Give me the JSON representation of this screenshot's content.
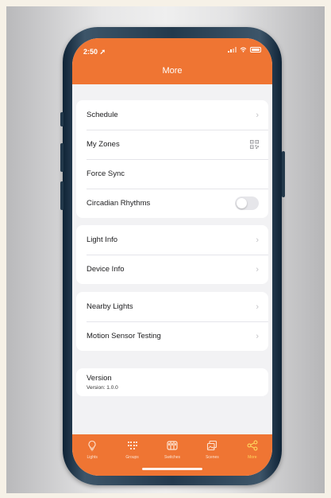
{
  "status_bar": {
    "time": "2:50 ➚"
  },
  "header": {
    "title": "More"
  },
  "groups": [
    {
      "rows": [
        {
          "label": "Schedule",
          "accessory": "chevron-icon"
        },
        {
          "label": "My Zones",
          "accessory": "qr-code-icon"
        },
        {
          "label": "Force Sync",
          "accessory": "none"
        },
        {
          "label": "Circadian Rhythms",
          "accessory": "toggle",
          "toggle_on": false
        }
      ]
    },
    {
      "rows": [
        {
          "label": "Light Info",
          "accessory": "chevron-icon"
        },
        {
          "label": "Device Info",
          "accessory": "chevron-icon"
        }
      ]
    },
    {
      "rows": [
        {
          "label": "Nearby Lights",
          "accessory": "chevron-icon"
        },
        {
          "label": "Motion Sensor Testing",
          "accessory": "chevron-icon"
        }
      ]
    }
  ],
  "version": {
    "title": "Version",
    "value": "Version: 1.0.0"
  },
  "tabs": [
    {
      "label": "Lights",
      "icon": "lightbulb-icon"
    },
    {
      "label": "Groups",
      "icon": "groups-icon"
    },
    {
      "label": "Switches",
      "icon": "switches-icon"
    },
    {
      "label": "Scenes",
      "icon": "scenes-icon"
    },
    {
      "label": "More",
      "icon": "share-icon",
      "active": true
    }
  ],
  "colors": {
    "accent": "#ef7533",
    "active_tab": "#ffd75e",
    "background": "#f2f2f4"
  }
}
